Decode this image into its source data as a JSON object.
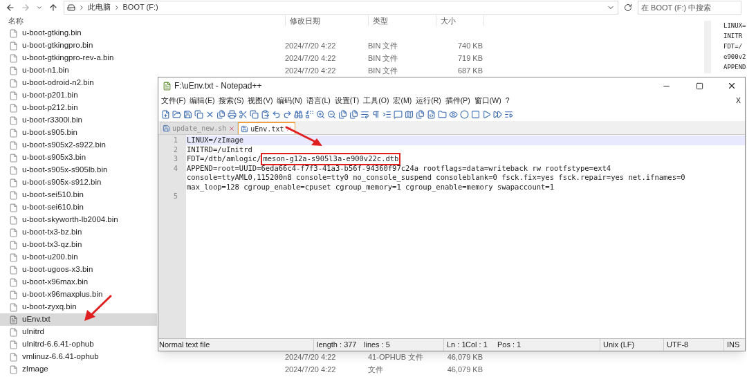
{
  "explorer": {
    "address": [
      "此电脑",
      "BOOT (F:)"
    ],
    "search": {
      "placeholder": "在 BOOT (F:) 中搜索"
    },
    "columns": [
      "名称",
      "修改日期",
      "类型",
      "大小"
    ],
    "files": [
      {
        "name": "u-boot-gtking.bin",
        "selected": false
      },
      {
        "name": "u-boot-gtkingpro.bin",
        "date": "2024/7/20 4:22",
        "type": "BIN 文件",
        "size": "740 KB",
        "selected": false
      },
      {
        "name": "u-boot-gtkingpro-rev-a.bin",
        "date": "2024/7/20 4:22",
        "type": "BIN 文件",
        "size": "719 KB",
        "selected": false
      },
      {
        "name": "u-boot-n1.bin",
        "date": "2024/7/20 4:22",
        "type": "BIN 文件",
        "size": "687 KB",
        "selected": false
      },
      {
        "name": "u-boot-odroid-n2.bin",
        "selected": false
      },
      {
        "name": "u-boot-p201.bin",
        "selected": false
      },
      {
        "name": "u-boot-p212.bin",
        "selected": false
      },
      {
        "name": "u-boot-r3300l.bin",
        "selected": false
      },
      {
        "name": "u-boot-s905.bin",
        "selected": false
      },
      {
        "name": "u-boot-s905x2-s922.bin",
        "selected": false
      },
      {
        "name": "u-boot-s905x3.bin",
        "selected": false
      },
      {
        "name": "u-boot-s905x-s905lb.bin",
        "selected": false
      },
      {
        "name": "u-boot-s905x-s912.bin",
        "selected": false
      },
      {
        "name": "u-boot-sei510.bin",
        "selected": false
      },
      {
        "name": "u-boot-sei610.bin",
        "selected": false
      },
      {
        "name": "u-boot-skyworth-lb2004.bin",
        "selected": false
      },
      {
        "name": "u-boot-tx3-bz.bin",
        "selected": false
      },
      {
        "name": "u-boot-tx3-qz.bin",
        "selected": false
      },
      {
        "name": "u-boot-u200.bin",
        "selected": false
      },
      {
        "name": "u-boot-ugoos-x3.bin",
        "selected": false
      },
      {
        "name": "u-boot-x96max.bin",
        "selected": false
      },
      {
        "name": "u-boot-x96maxplus.bin",
        "selected": false
      },
      {
        "name": "u-boot-zyxq.bin",
        "selected": false
      },
      {
        "name": "uEnv.txt",
        "selected": true
      },
      {
        "name": "uInitrd",
        "selected": false
      },
      {
        "name": "uInitrd-6.6.41-ophub",
        "selected": false
      },
      {
        "name": "vmlinuz-6.6.41-ophub",
        "date": "2024/7/20 4:22",
        "type": "41-OPHUB 文件",
        "size": "46,079 KB",
        "selected": false
      },
      {
        "name": "zImage",
        "date": "2024/7/20 4:22",
        "type": "文件",
        "size": "46,079 KB",
        "selected": false
      }
    ],
    "preview": [
      "LINUX=",
      "INITR",
      "FDT=/",
      "e900v2",
      "APPEND"
    ]
  },
  "notepad": {
    "title": "F:\\uEnv.txt - Notepad++",
    "menu": [
      "文件(F)",
      "编辑(E)",
      "搜索(S)",
      "视图(V)",
      "编码(N)",
      "语言(L)",
      "设置(T)",
      "工具(O)",
      "宏(M)",
      "运行(R)",
      "插件(P)",
      "窗口(W)",
      "?"
    ],
    "menu_close": "X",
    "tabs": [
      {
        "label": "update_new.sh",
        "selected": false
      },
      {
        "label": "uEnv.txt",
        "selected": true
      }
    ],
    "lines": [
      {
        "number": "1",
        "text": [
          "LINUX=/zImage"
        ],
        "current": true
      },
      {
        "number": "2",
        "text": [
          "INITRD=/uInitrd"
        ],
        "current": false
      },
      {
        "number": "3",
        "text": [
          "FDT=/dtb/amlogic/"
        ],
        "boxed": "meson-g12a-s905l3a-e900v22c.dtb",
        "current": false
      },
      {
        "number": "4",
        "text": [
          "APPEND=root=UUID=6eda66c4-f7f3-41a3-b56f-94360f97c24a rootflags=data=writeback rw rootfstype=ext4",
          "console=ttyAML0,115200n8 console=tty0 no_console_suspend consoleblank=0 fsck.fix=yes fsck.repair=yes net.ifnames=0",
          "max_loop=128 cgroup_enable=cpuset cgroup_memory=1 cgroup_enable=memory swapaccount=1"
        ],
        "current": false
      },
      {
        "number": "5",
        "current": false
      }
    ],
    "status": [
      "Normal text file",
      "length : 377",
      "lines : 5",
      "Ln : 1",
      "Col : 1",
      "Pos : 1",
      "Unix (LF)",
      "UTF-8",
      "INS"
    ]
  }
}
